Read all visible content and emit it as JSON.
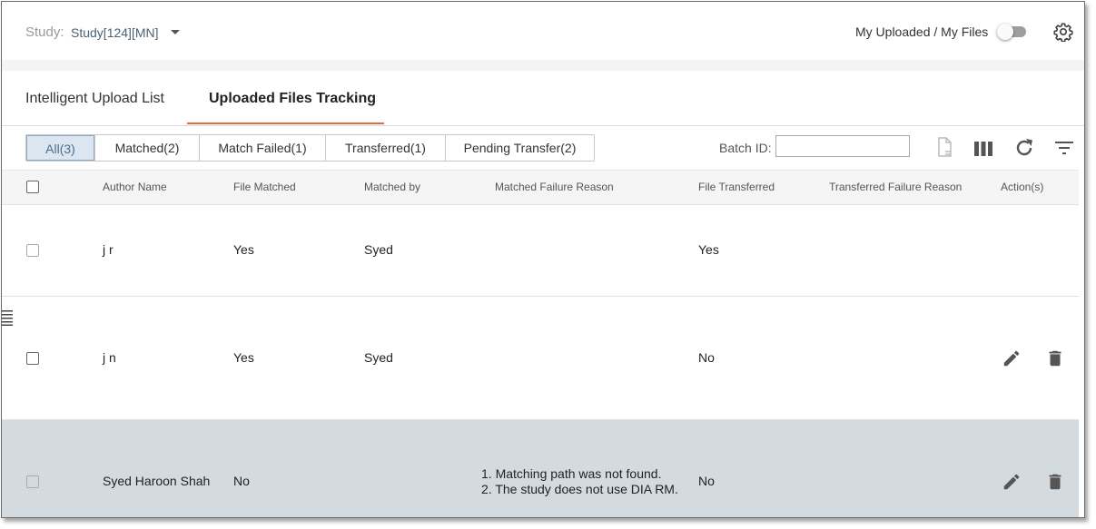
{
  "header": {
    "study_label": "Study:",
    "study_value": "Study[124][MN]",
    "toggle_label": "My Uploaded / My Files"
  },
  "tabs": [
    {
      "label": "Intelligent Upload List",
      "active": false
    },
    {
      "label": "Uploaded Files Tracking",
      "active": true
    }
  ],
  "filters": [
    {
      "label": "All(3)",
      "active": true
    },
    {
      "label": "Matched(2)",
      "active": false
    },
    {
      "label": "Match Failed(1)",
      "active": false
    },
    {
      "label": "Transferred(1)",
      "active": false
    },
    {
      "label": "Pending Transfer(2)",
      "active": false
    }
  ],
  "batch": {
    "label": "Batch ID:",
    "value": ""
  },
  "table": {
    "columns": [
      "Author Name",
      "File Matched",
      "Matched by",
      "Matched Failure Reason",
      "File Transferred",
      "Transferred Failure Reason",
      "Action(s)"
    ],
    "rows": [
      {
        "author": "j r",
        "file_matched": "Yes",
        "matched_by": "Syed",
        "reason_line1": "",
        "reason_line2": "",
        "file_transferred": "Yes"
      },
      {
        "author": "j n",
        "file_matched": "Yes",
        "matched_by": "Syed",
        "reason_line1": "",
        "reason_line2": "",
        "file_transferred": "No"
      },
      {
        "author": "Syed Haroon Shah",
        "file_matched": "No",
        "matched_by": "",
        "reason_line1": "1. Matching path was not found.",
        "reason_line2": "2. The study does not use DIA RM.",
        "file_transferred": "No"
      }
    ]
  },
  "icons": [
    "chevron-down-icon",
    "gear-icon",
    "file-export-icon",
    "columns-icon",
    "refresh-icon",
    "filter-icon",
    "edit-icon",
    "delete-icon",
    "drag-handle-icon"
  ],
  "colors": {
    "accent": "#e36a3a",
    "active_filter_bg": "#dbe6f1",
    "selected_row_bg": "#d3dae0",
    "study_value": "#4b6172"
  }
}
